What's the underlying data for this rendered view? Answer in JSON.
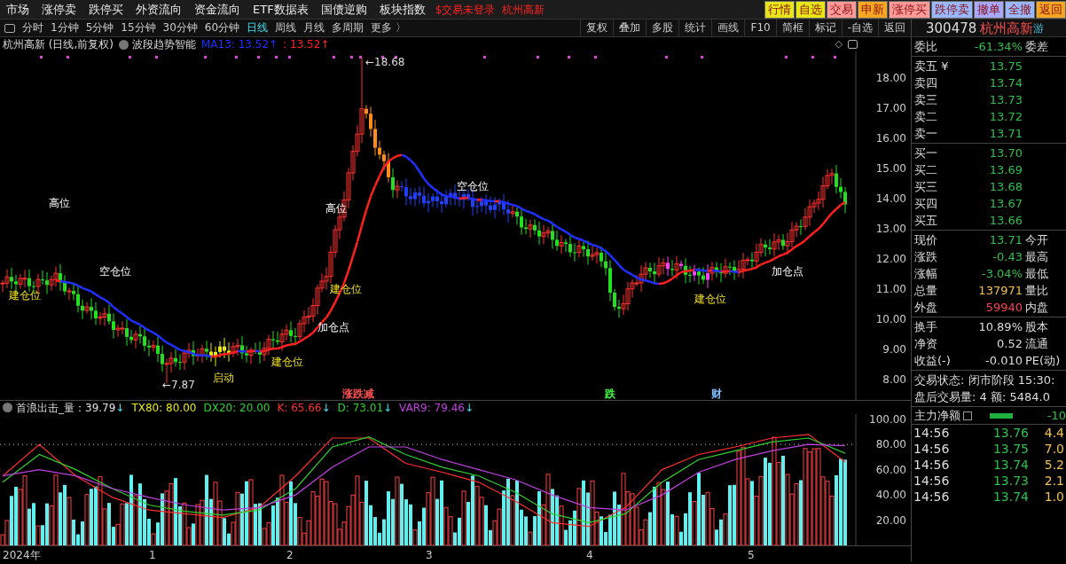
{
  "menu": {
    "items": [
      "市场",
      "涨停卖",
      "跌停买",
      "外资流向",
      "资金流向",
      "ETF数据表",
      "国债逆购",
      "板块指数"
    ],
    "login_notice": "$交易未登录",
    "stock_name": "杭州高新",
    "buttons": [
      {
        "label": "行情",
        "color": "#e6e619"
      },
      {
        "label": "自选",
        "color": "#e6e619"
      },
      {
        "label": "交易",
        "color": "#ff9a9a"
      },
      {
        "label": "申新",
        "color": "#f5a623"
      },
      {
        "label": "涨停买",
        "color": "#ff9a9a"
      },
      {
        "label": "跌停卖",
        "color": "#9ab8ff"
      },
      {
        "label": "撤单",
        "color": "#a8a8ff"
      },
      {
        "label": "全撤",
        "color": "#9ab8ff"
      },
      {
        "label": "返回",
        "color": "#f5a623"
      }
    ]
  },
  "periods": [
    {
      "label": "分时",
      "selected": false
    },
    {
      "label": "1分钟",
      "selected": false
    },
    {
      "label": "5分钟",
      "selected": false
    },
    {
      "label": "15分钟",
      "selected": false
    },
    {
      "label": "30分钟",
      "selected": false
    },
    {
      "label": "60分钟",
      "selected": false
    },
    {
      "label": "日线",
      "selected": true
    },
    {
      "label": "周线",
      "selected": false
    },
    {
      "label": "月线",
      "selected": false
    },
    {
      "label": "多周期",
      "selected": false
    },
    {
      "label": "更多 〉",
      "selected": false
    }
  ],
  "tools": [
    "复权",
    "叠加",
    "多股",
    "统计",
    "画线",
    "F10",
    "简框",
    "标记",
    "-自选",
    "返回"
  ],
  "chart": {
    "title": "杭州高新 (日线,前复权)",
    "indicator": "波段趋势智能",
    "ma": "MA13: 13.52↑",
    "ma2": ": 13.52↑",
    "diamond": "◇",
    "price_axis": [
      "18.00",
      "17.00",
      "16.00",
      "15.00",
      "14.00",
      "13.00",
      "12.00",
      "11.00",
      "10.00",
      "9.00",
      "8.00"
    ],
    "annotations": [
      {
        "text": "高位",
        "kind": "white"
      },
      {
        "text": "建仓位",
        "kind": "yellow"
      },
      {
        "text": "空仓位",
        "kind": "white"
      },
      {
        "text": "启动",
        "kind": "yellow"
      },
      {
        "text": "建仓位",
        "kind": "yellow"
      },
      {
        "text": "加仓点",
        "kind": "white"
      },
      {
        "text": "高位",
        "kind": "white"
      },
      {
        "text": "建仓位",
        "kind": "yellow"
      },
      {
        "text": "空仓位",
        "kind": "white"
      },
      {
        "text": "建仓位",
        "kind": "yellow"
      },
      {
        "text": "加仓点",
        "kind": "white"
      }
    ],
    "high_label": "←18.68",
    "low_label": "←7.87",
    "markers": [
      {
        "text": "涨跌减",
        "color": "#ff5050"
      },
      {
        "text": "跌",
        "color": "#40ff40"
      },
      {
        "text": "财",
        "color": "#80c0ff"
      }
    ]
  },
  "indicator": {
    "title": "首浪出击_量",
    "values": [
      {
        "text": "：39.79",
        "color": "#e0e0e0",
        "arrow": "↓"
      },
      {
        "text": "TX80: 80.00",
        "color": "#e6e619"
      },
      {
        "text": "DX20: 20.00",
        "color": "#30d030"
      },
      {
        "kind": "series",
        "reading": ": 65.66",
        "arrow": "↓"
      },
      {
        "kind": "series",
        "reading": ": 73.01",
        "arrow": "↓"
      },
      {
        "kind": "series",
        "reading": ": 79.46",
        "arrow": "↓"
      }
    ],
    "chart_data": {
      "type": "line",
      "ylim": [
        0,
        104
      ],
      "yticks": [
        {
          "value": 20,
          "label": "20.00"
        },
        {
          "value": 40,
          "label": "40.00"
        },
        {
          "value": 60,
          "label": "60.00"
        },
        {
          "value": 80,
          "label": "80.00"
        },
        {
          "value": 100,
          "label": "100.00"
        }
      ],
      "series": [
        {
          "name": "K",
          "color": "#ff3030",
          "values": [
            55,
            80,
            55,
            38,
            28,
            25,
            22,
            30,
            55,
            85,
            85,
            65,
            58,
            50,
            35,
            18,
            15,
            30,
            60,
            72,
            78,
            85,
            88,
            66
          ]
        },
        {
          "name": "D",
          "color": "#30d030",
          "values": [
            50,
            72,
            60,
            45,
            32,
            27,
            24,
            28,
            45,
            78,
            86,
            72,
            62,
            55,
            42,
            25,
            18,
            25,
            50,
            68,
            75,
            82,
            85,
            73
          ]
        },
        {
          "name": "VAR9",
          "color": "#c040e0",
          "values": [
            55,
            60,
            55,
            45,
            38,
            32,
            28,
            30,
            40,
            62,
            78,
            78,
            68,
            60,
            52,
            40,
            30,
            28,
            40,
            58,
            68,
            75,
            80,
            79
          ]
        }
      ]
    },
    "dates": [
      "2024年",
      "1",
      "2",
      "3",
      "4",
      "5"
    ]
  },
  "quote": {
    "code": "300478",
    "name": "杭州高新",
    "extra": "游",
    "ratio": {
      "label": "委比",
      "value": "-61.34%",
      "label2": "委差"
    },
    "asks": [
      {
        "label": "卖五 ¥",
        "price": "13.75"
      },
      {
        "label": "卖四",
        "price": "13.74"
      },
      {
        "label": "卖三",
        "price": "13.73"
      },
      {
        "label": "卖二",
        "price": "13.72"
      },
      {
        "label": "卖一",
        "price": "13.71"
      }
    ],
    "bids": [
      {
        "label": "买一",
        "price": "13.70"
      },
      {
        "label": "买二",
        "price": "13.69"
      },
      {
        "label": "买三",
        "price": "13.68"
      },
      {
        "label": "买四",
        "price": "13.67"
      },
      {
        "label": "买五",
        "price": "13.66"
      }
    ],
    "stats": [
      {
        "label": "现价",
        "value": "13.71",
        "color": "#2fbf4f",
        "label2": "今开"
      },
      {
        "label": "涨跌",
        "value": "-0.43",
        "color": "#2fbf4f",
        "label2": "最高"
      },
      {
        "label": "涨幅",
        "value": "-3.04%",
        "color": "#2fbf4f",
        "label2": "最低"
      },
      {
        "label": "总量",
        "value": "137971",
        "color": "#f0c050",
        "label2": "量比"
      },
      {
        "label": "外盘",
        "value": "59940",
        "color": "#ff4050",
        "label2": "内盘"
      }
    ],
    "details": [
      {
        "label": "换手",
        "value": "10.89%",
        "color": "#dddddd",
        "label2": "股本"
      },
      {
        "label": "净资",
        "value": "0.52",
        "color": "#dddddd",
        "label2": "流通"
      },
      {
        "label": "收益(-)",
        "value": "-0.010",
        "color": "#dddddd",
        "label2": "PE(动)"
      }
    ],
    "status": [
      "交易状态: 闭市阶段 15:30:",
      "盘后交易量: 4  额: 5484.0"
    ],
    "flow": {
      "label": "主力净额",
      "value": "-10"
    },
    "ticks": [
      {
        "time": "14:56",
        "price": "13.76",
        "volume": "4.4"
      },
      {
        "time": "14:56",
        "price": "13.75",
        "volume": "7.0"
      },
      {
        "time": "14:56",
        "price": "13.74",
        "volume": "5.2"
      },
      {
        "time": "14:56",
        "price": "13.73",
        "volume": "2.1"
      },
      {
        "time": "14:56",
        "price": "13.74",
        "volume": "1.0"
      }
    ]
  }
}
